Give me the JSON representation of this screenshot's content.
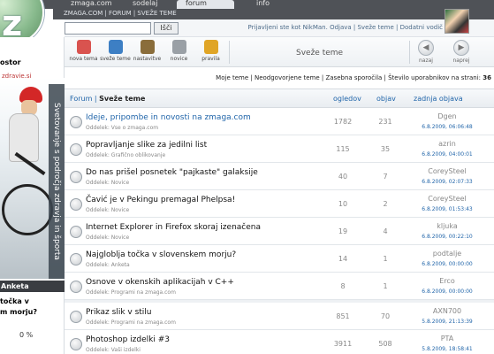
{
  "top_tabs": [
    "zmaga.com",
    "sodelaj",
    "forum",
    "info"
  ],
  "subnav": "ZMAGA.COM | FORUM | SVEŽE TEME",
  "search": {
    "button": "Išči",
    "placeholder": ""
  },
  "user_info": "Prijavljeni ste kot NikMan. Odjava | Sveže teme | Dodatni vodič",
  "left": {
    "kostor": "ostor",
    "brand": "zdravje.si",
    "vertical_text": "Svetovanje s področja zdravja in športa",
    "anketa_title": "Anketa",
    "anketa_question": "točka v\nm morju?",
    "anketa_percent": "0 %"
  },
  "toolbar": {
    "tools": [
      {
        "label": "nova tema",
        "icon": "new-topic-icon",
        "color": "#d9534f"
      },
      {
        "label": "sveže teme",
        "icon": "fresh-topics-icon",
        "color": "#3d7fc4"
      },
      {
        "label": "nastavitve",
        "icon": "settings-icon",
        "color": "#8a6d3b"
      },
      {
        "label": "novice",
        "icon": "news-icon",
        "color": "#9aa0a6"
      },
      {
        "label": "pravila",
        "icon": "rules-icon",
        "color": "#e0a526"
      }
    ],
    "center_title": "Sveže teme",
    "back": "nazaj",
    "forward": "naprej"
  },
  "links_row": {
    "text": "Moje teme | Neodgovorjene teme | Zasebna sporočila | Število uporabnikov na strani:",
    "count": "36"
  },
  "table": {
    "breadcrumb_forum": "Forum",
    "breadcrumb_current": "Sveže teme",
    "col_views": "ogledov",
    "col_posts": "objav",
    "col_last": "zadnja objava",
    "rows": [
      {
        "title": "Ideje, pripombe in novosti na zmaga.com",
        "section": "Oddelek: Vse o zmaga.com",
        "views": "1782",
        "posts": "231",
        "user": "Dgen",
        "date": "6.8.2009, 06:06:48",
        "highlight": true
      },
      {
        "title": "Popravljanje slike za jedilni list",
        "section": "Oddelek: Grafično oblikovanje",
        "views": "115",
        "posts": "35",
        "user": "azrin",
        "date": "6.8.2009, 04:00:01",
        "highlight": false
      },
      {
        "title": "Do nas prišel posnetek \"pajkaste\" galaksije",
        "section": "Oddelek: Novice",
        "views": "40",
        "posts": "7",
        "user": "CoreySteel",
        "date": "6.8.2009, 02:07:33",
        "highlight": false
      },
      {
        "title": "Čavić je v Pekingu premagal Phelpsa!",
        "section": "Oddelek: Novice",
        "views": "10",
        "posts": "2",
        "user": "CoreySteel",
        "date": "6.8.2009, 01:53:43",
        "highlight": false
      },
      {
        "title": "Internet Explorer in Firefox skoraj izenačena",
        "section": "Oddelek: Novice",
        "views": "19",
        "posts": "4",
        "user": "kljuka",
        "date": "6.8.2009, 00:22:10",
        "highlight": false
      },
      {
        "title": "Najgloblja točka v slovenskem morju?",
        "section": "Oddelek: Anketa",
        "views": "14",
        "posts": "1",
        "user": "podtalje",
        "date": "6.8.2009, 00:00:00",
        "highlight": false
      },
      {
        "title": "Osnove v okenskih aplikacijah v C++",
        "section": "Oddelek: Programi na zmaga.com",
        "views": "8",
        "posts": "1",
        "user": "Erco",
        "date": "6.8.2009, 00:00:00",
        "highlight": false
      },
      {
        "title": "Prikaz slik v stilu",
        "section": "Oddelek: Programi na zmaga.com",
        "views": "851",
        "posts": "70",
        "user": "AXN700",
        "date": "5.8.2009, 21:13:39",
        "highlight": false
      },
      {
        "title": "Photoshop izdelki #3",
        "section": "Oddelek: Vaši izdelki",
        "views": "3911",
        "posts": "508",
        "user": "PTA",
        "date": "5.8.2009, 18:58:41",
        "highlight": false
      }
    ]
  }
}
